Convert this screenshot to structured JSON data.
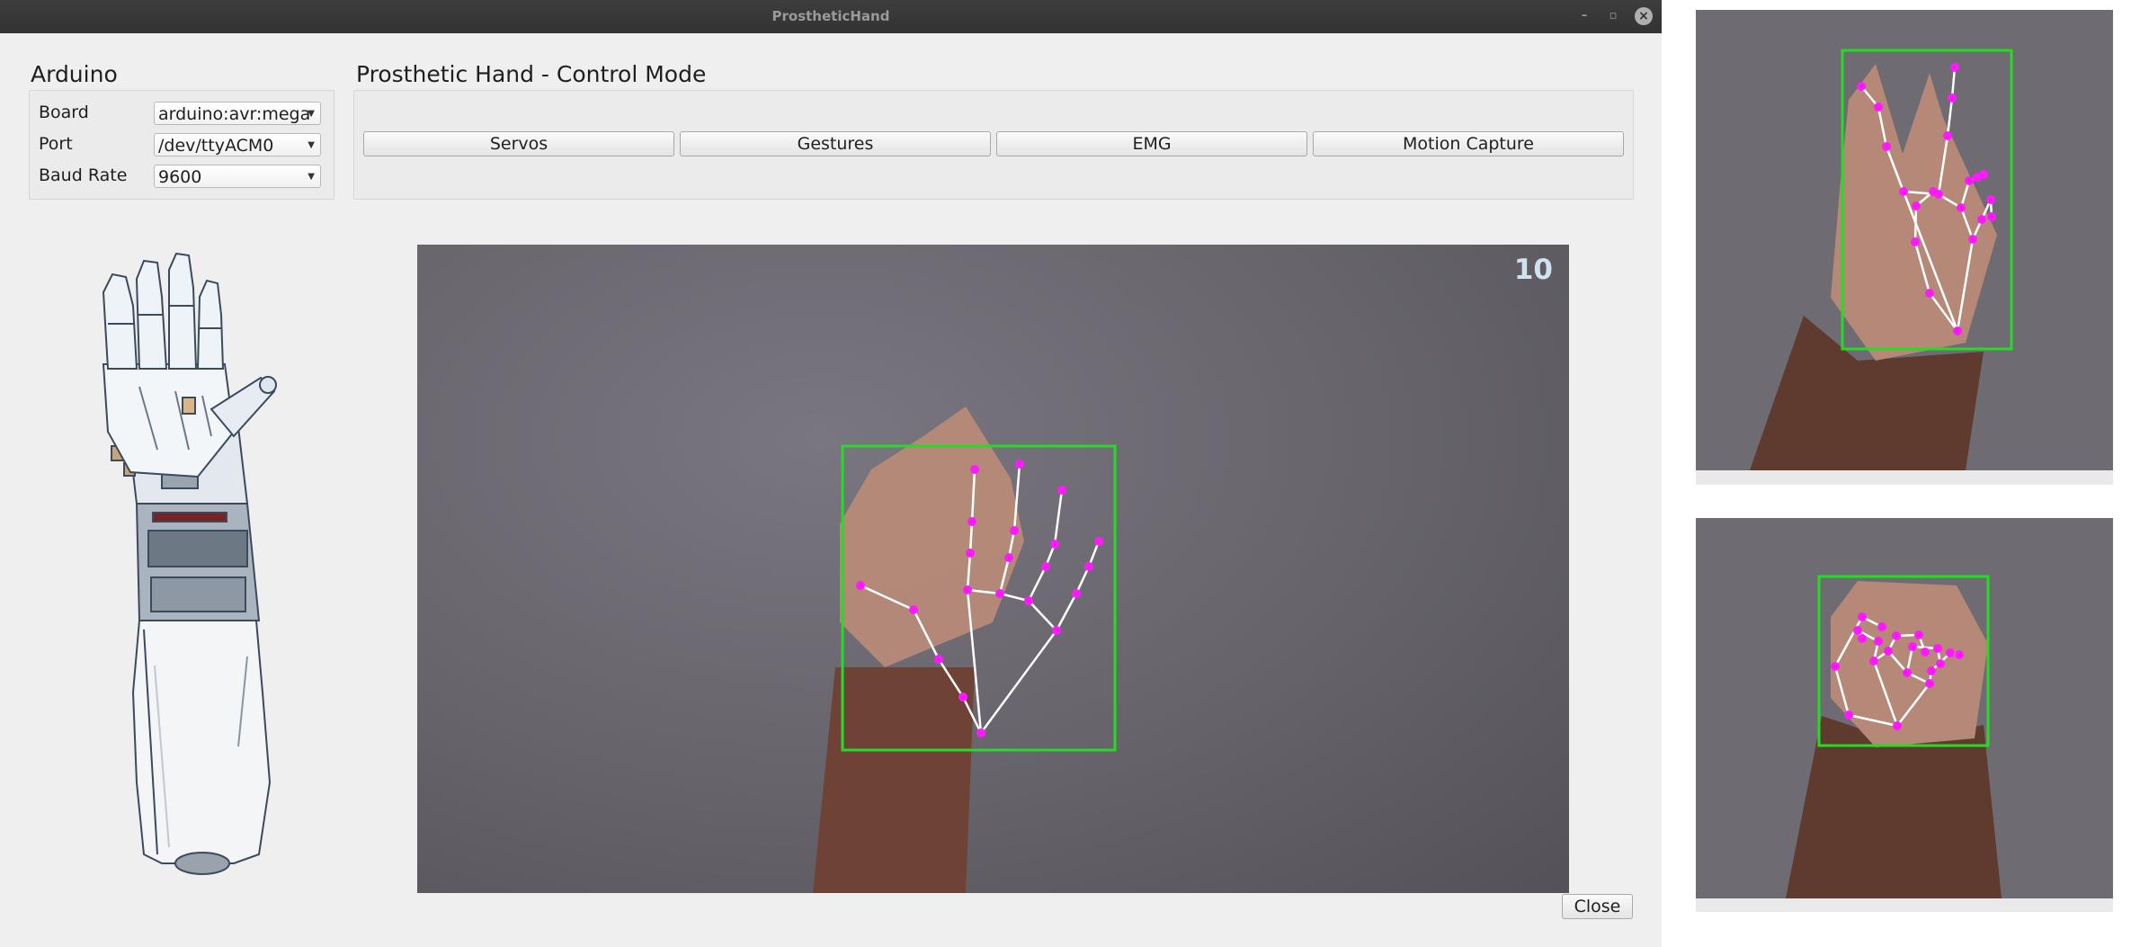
{
  "window": {
    "title": "ProstheticHand",
    "minimize_icon": "–",
    "maximize_icon": "▫",
    "close_icon": "×"
  },
  "arduino": {
    "title": "Arduino",
    "fields": [
      {
        "label": "Board",
        "value": "arduino:avr:mega"
      },
      {
        "label": "Port",
        "value": "/dev/ttyACM0"
      },
      {
        "label": "Baud Rate",
        "value": "9600"
      }
    ]
  },
  "control": {
    "title": "Prosthetic Hand - Control Mode",
    "modes": [
      "Servos",
      "Gestures",
      "EMG",
      "Motion Capture"
    ]
  },
  "video": {
    "frame_counter": "10"
  },
  "footer": {
    "close_label": "Close"
  },
  "colors": {
    "bbox": "#22dd22",
    "landmark": "#ff19ff",
    "skeleton": "#ffffff"
  }
}
